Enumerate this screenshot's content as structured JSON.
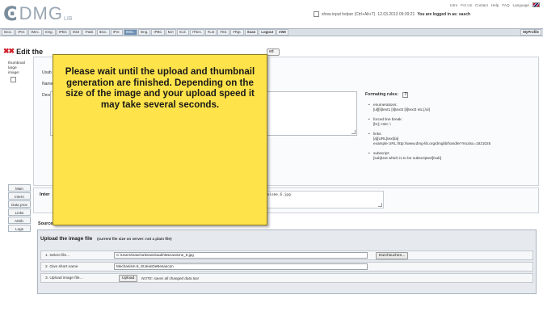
{
  "header": {
    "logo_text": "DMG",
    "logo_suffix": "LIB",
    "toplinks": [
      "Intro",
      "For Us",
      "Contact",
      "Help",
      "FAQ",
      "Language"
    ],
    "input_helper": "show input helper (Ctrl+Alt+T)",
    "timestamp": "12.03.2013 09:39:21",
    "logged_in": "You are logged in as: sasch"
  },
  "nav": {
    "items": [
      "IDoc.",
      "IPer.",
      "IMec.",
      "IImg.",
      "IPBC",
      "IMJI",
      "ITask",
      "IDoc.",
      "IPer.",
      "IMec.",
      "IImg.",
      "IPBC",
      "MJI",
      "ICol.",
      "IThes.",
      "#Lst",
      "#Str.",
      "#Rgt.",
      "Scan",
      "Logout",
      "eWe"
    ],
    "active_index": 9,
    "right_label": "MyProfile"
  },
  "page": {
    "title": "Edit the",
    "saved_btn": "ed"
  },
  "thumb": {
    "label_lines": [
      "thumbnail",
      "large",
      "image:"
    ]
  },
  "form": {
    "usab_label": "Usab",
    "name_label": "Name",
    "desc_label": "Desc"
  },
  "formatting": {
    "title": "Formating rules:",
    "help_icon": "?",
    "items": [
      {
        "head": "enumerations:",
        "body": "[ul][li]text1 [li]text2 [li]text3 etc.[/ul]"
      },
      {
        "head": "forced line break:",
        "body": "[br]; Hint: \\"
      },
      {
        "head": "links:",
        "body": "[a][URL]text[/a]",
        "extra": "example URL:http://www.dmg-lib.org/dmglib/handler?mcdsc=1821025"
      },
      {
        "head": "subscript:",
        "body": "[sub]text which is to be subscripted[/sub]"
      }
    ]
  },
  "tabs": [
    "Main",
    "Intern",
    "Data prov",
    "Links",
    "Attrib.",
    "Logs"
  ],
  "intern": {
    "label": "Inter",
    "value": "anisme_6.jpg"
  },
  "source": {
    "label": "Source"
  },
  "upload": {
    "title": "Upload the image file",
    "subtitle": "(current file size on server: not a plain file)",
    "rows": [
      {
        "label": "1. Select file...",
        "value": "C:\\Users\\Sascha\\Downloads\\Mecanisme_6.jpg",
        "button": "Durchsuchen..."
      },
      {
        "label": "2. Give short name",
        "value": "Mechanism-6_StJeanDeBesancon"
      },
      {
        "label": "3. Upload image file...",
        "button": "Upload",
        "note": "NOTE: saves all changed data too!"
      }
    ]
  },
  "modal": {
    "message": "Please wait until the upload and thumbnail generation are finished. Depending on the size of the image and your upload speed it may take several seconds."
  },
  "colors": {
    "modal_bg": "#ffe34a",
    "nav_active": "#6c8fb3",
    "title_x": "#d0202a"
  }
}
